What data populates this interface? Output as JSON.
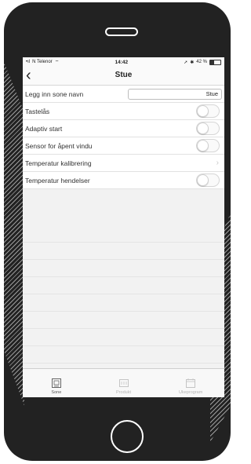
{
  "status_bar": {
    "carrier": "N Telenor",
    "time": "14:42",
    "battery": "42 %"
  },
  "nav": {
    "title": "Stue"
  },
  "rows": [
    {
      "label": "Legg inn sone navn",
      "value": "Stue"
    },
    {
      "label": "Tastelås",
      "toggle": false
    },
    {
      "label": "Adaptiv start",
      "toggle": false
    },
    {
      "label": "Sensor for åpent vindu",
      "toggle": false
    },
    {
      "label": "Temperatur kalibrering"
    },
    {
      "label": "Temperatur hendelser",
      "toggle": false
    }
  ],
  "tabs": [
    {
      "label": "Sone",
      "icon": "zone-icon",
      "active": true
    },
    {
      "label": "Produkt",
      "icon": "product-icon",
      "active": false
    },
    {
      "label": "Ukeprogram",
      "icon": "calendar-icon",
      "active": false
    }
  ]
}
